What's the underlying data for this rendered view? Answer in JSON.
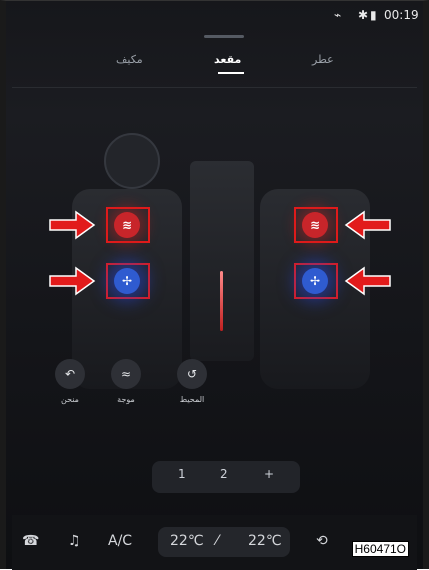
{
  "status": {
    "time": "00:19",
    "icons": [
      "usb-icon",
      "bluetooth-icon",
      "signal-icon"
    ]
  },
  "tabs": [
    {
      "label": "عطر",
      "active": false
    },
    {
      "label": "مقعد",
      "active": true
    },
    {
      "label": "مكيف",
      "active": false
    }
  ],
  "seat_controls": {
    "driver_heat_icon": "≋",
    "driver_vent_icon": "✢",
    "passenger_heat_icon": "≋",
    "passenger_vent_icon": "✢"
  },
  "modes": [
    {
      "label": "منحن",
      "icon": "↶"
    },
    {
      "label": "موجة",
      "icon": "≈"
    },
    {
      "label": "المحيط",
      "icon": "↺"
    }
  ],
  "rear_buttons": [
    "1",
    "2",
    "+"
  ],
  "bottom_bar": {
    "phone_icon": "☎",
    "music_icon": "♫",
    "ac_label": "A/C",
    "temp_left": "22℃",
    "temp_right": "22℃",
    "fan_icon": "⁄",
    "recirc_icon": "⟲"
  },
  "watermark": "H60471O",
  "colors": {
    "heat": "#c8252a",
    "vent": "#2f5bd0",
    "annotation_red": "#e21b1b"
  }
}
